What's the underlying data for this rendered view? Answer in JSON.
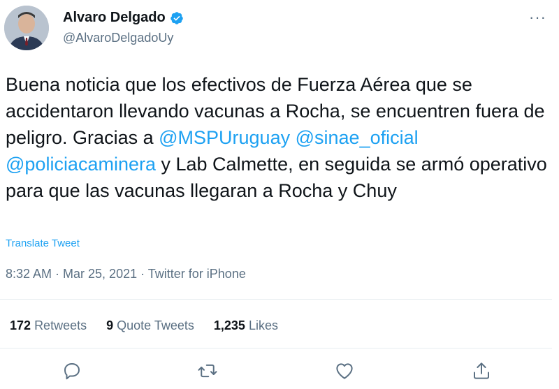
{
  "author": {
    "display_name": "Alvaro Delgado",
    "handle": "@AlvaroDelgadoUy"
  },
  "tweet": {
    "segments": [
      {
        "text": "Buena noticia que los efectivos de Fuerza Aérea que se accidentaron llevando vacunas a Rocha, se encuentren fuera de peligro. Gracias a ",
        "mention": false
      },
      {
        "text": "@MSPUruguay",
        "mention": true
      },
      {
        "text": " ",
        "mention": false
      },
      {
        "text": "@sinae_oficial",
        "mention": true
      },
      {
        "text": " ",
        "mention": false
      },
      {
        "text": "@policiacaminera",
        "mention": true
      },
      {
        "text": " y Lab Calmette, en seguida se armó operativo para que las vacunas llegaran a Rocha y Chuy",
        "mention": false
      }
    ],
    "translate_label": "Translate Tweet",
    "meta": "8:32 AM · Mar 25, 2021 · Twitter for iPhone"
  },
  "stats": {
    "retweets_count": "172",
    "retweets_label": "Retweets",
    "quotes_count": "9",
    "quotes_label": "Quote Tweets",
    "likes_count": "1,235",
    "likes_label": "Likes"
  },
  "colors": {
    "accent": "#1da1f2",
    "muted": "#5b7083",
    "text": "#0f1419",
    "divider": "#e6ecf0"
  },
  "icons": {
    "more": "more-dots-icon",
    "verified": "verified-badge-icon",
    "reply": "reply-icon",
    "retweet": "retweet-icon",
    "like": "heart-icon",
    "share": "share-icon"
  }
}
